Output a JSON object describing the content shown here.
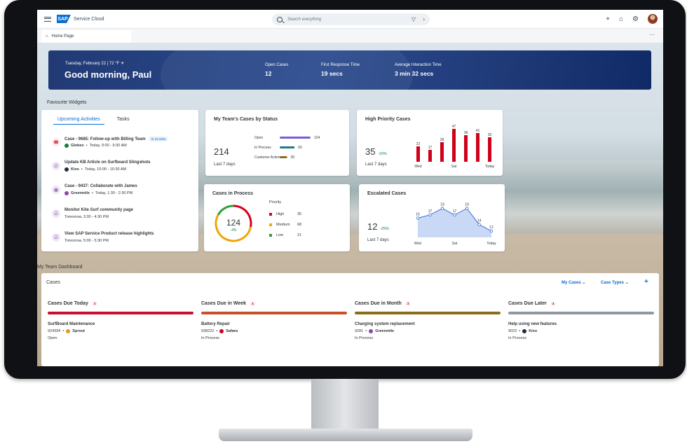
{
  "shell": {
    "brand": "SAP",
    "product": "Service Cloud",
    "search_placeholder": "Search everything"
  },
  "tab": {
    "home_label": "Home Page",
    "more": "···"
  },
  "banner": {
    "date_weather": "Tuesday, February 22 | 72 °F",
    "greeting": "Good morning, Paul",
    "kpis": [
      {
        "label": "Open Cases",
        "value": "12"
      },
      {
        "label": "First Response Time",
        "value": "19 secs"
      },
      {
        "label": "Average Interaction Time",
        "value": "3 min 32 secs"
      }
    ]
  },
  "favourites": {
    "section_label": "Favourite Widgets",
    "activities": {
      "tabs": [
        "Upcoming Activities",
        "Tasks"
      ],
      "items": [
        {
          "title": "Case - 9685: Follow-up with Billing Team",
          "badge": "In 15 Mins",
          "org": "Globex",
          "org_color": "#107e3e",
          "time": "Today, 9:00 - 9:30 AM",
          "icon": "phone-icon"
        },
        {
          "title": "Update KB Article on Surfboard Slingshots",
          "badge": "",
          "org": "Kixo",
          "org_color": "#1d2d3e",
          "time": "Today, 10:00 - 10:30 AM",
          "icon": "task-icon"
        },
        {
          "title": "Case - 9437: Collaborate with James",
          "badge": "",
          "org": "Greenmile",
          "org_color": "#8e44ad",
          "time": "Today, 1:30 - 2:30 PM",
          "icon": "calendar-icon"
        },
        {
          "title": "Monitor Kite Surf community page",
          "badge": "",
          "org": "",
          "org_color": "",
          "time": "Tomorrow, 3:30 - 4:30 PM",
          "icon": "task-icon"
        },
        {
          "title": "View SAP Service Product release highlights",
          "badge": "",
          "org": "",
          "org_color": "",
          "time": "Tomorrow, 5:00 - 5:30 PM",
          "icon": "task-icon"
        }
      ]
    },
    "team_cases": {
      "title": "My Team's Cases by Status",
      "total": "214",
      "period": "Last 7 days",
      "chart_data": {
        "type": "bar",
        "categories": [
          "Open",
          "In Process",
          "Customer Action"
        ],
        "values": [
          124,
          60,
          30
        ],
        "colors": [
          "#7b5cd6",
          "#1f7a8c",
          "#8a6d1c"
        ],
        "orientation": "horizontal"
      }
    },
    "high_priority": {
      "title": "High Priority Cases",
      "total": "35",
      "trend": "-15%",
      "period": "Last 7 days",
      "chart_data": {
        "type": "bar",
        "categories": [
          "Wed",
          "",
          "",
          "Sat",
          "",
          "",
          "Today"
        ],
        "x_tick_labels": [
          "Wed",
          "Sat",
          "Today"
        ],
        "values": [
          22,
          17,
          28,
          47,
          38,
          41,
          35
        ],
        "color": "#d0021b"
      }
    },
    "in_process": {
      "title": "Cases in Process",
      "total": "124",
      "trend": "-4%",
      "priority_label": "Priority",
      "chart_data": {
        "type": "pie",
        "categories": [
          "High",
          "Medium",
          "Low"
        ],
        "values": [
          35,
          68,
          21
        ],
        "colors": [
          "#d0021b",
          "#f0a500",
          "#2e9e3e"
        ]
      }
    },
    "escalated": {
      "title": "Escalated Cases",
      "total": "12",
      "trend": "-25%",
      "period": "Last 7 days",
      "chart_data": {
        "type": "area",
        "x": [
          "Wed",
          "",
          "",
          "Sat",
          "",
          "",
          "Today"
        ],
        "x_tick_labels": [
          "Wed",
          "Sat",
          "Today"
        ],
        "values": [
          16,
          17,
          19,
          17,
          19,
          14,
          12
        ],
        "color": "#3a6fd8"
      }
    }
  },
  "dashboard": {
    "section_label": "My Team Dashboard",
    "title": "Cases",
    "controls": [
      "My Cases",
      "Case Types"
    ],
    "columns": [
      {
        "title": "Cases Due Today",
        "count": "3",
        "bar_color": "#c8102e",
        "item_title": "SurfBoard Maintenance",
        "item_id": "924394",
        "org": "Sprout",
        "org_color": "#e8962a",
        "status": "Open"
      },
      {
        "title": "Cases Due in Week",
        "count": "4",
        "bar_color": "#c8502a",
        "item_title": "Battery Repair",
        "item_id": "938222",
        "org": "Safara",
        "org_color": "#d0021b",
        "status": "In Process"
      },
      {
        "title": "Cases Due in Month",
        "count": "3",
        "bar_color": "#8a6d1c",
        "item_title": "Charging system replacement",
        "item_id": "9281",
        "org": "Greenmile",
        "org_color": "#8e44ad",
        "status": "In Process"
      },
      {
        "title": "Cases Due Later",
        "count": "4",
        "bar_color": "#8f98a3",
        "item_title": "Help using new features",
        "item_id": "9023",
        "org": "Kixo",
        "org_color": "#1d2d3e",
        "status": "In Process"
      }
    ]
  }
}
